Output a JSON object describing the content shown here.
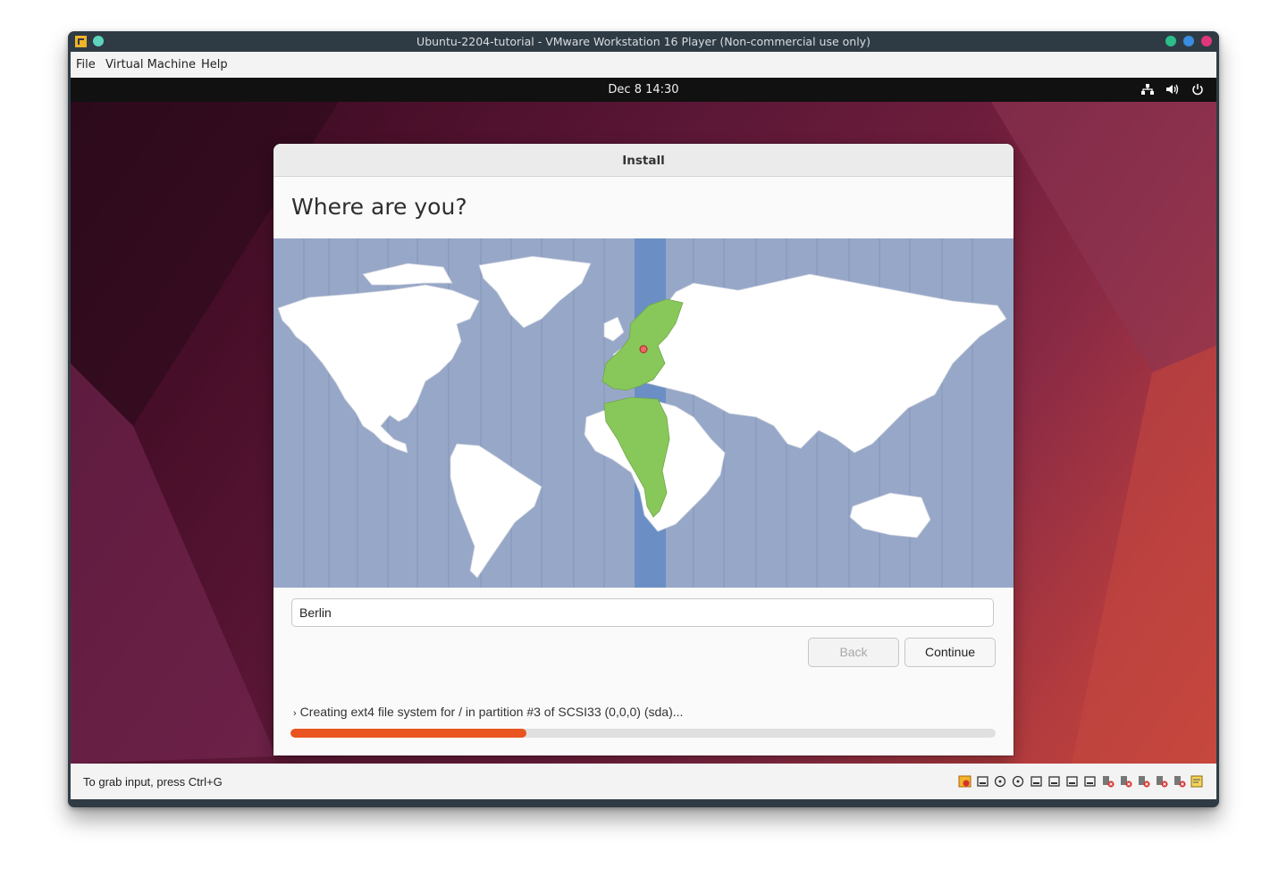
{
  "window": {
    "title": "Ubuntu-2204-tutorial - VMware Workstation 16 Player (Non-commercial use only)",
    "title_dot_colors": [
      "#5fd3be",
      "#2bbe8b",
      "#3a8de0",
      "#e0367a"
    ]
  },
  "menubar": {
    "items": [
      "File",
      "Virtual Machine",
      "Help"
    ]
  },
  "topbar": {
    "clock": "Dec 8  14:30",
    "icons": [
      "network-icon",
      "volume-icon",
      "power-icon"
    ]
  },
  "installer": {
    "window_title": "Install",
    "heading": "Where are you?",
    "city_value": "Berlin",
    "back_label": "Back",
    "continue_label": "Continue",
    "progress_text": "Creating ext4 file system for / in partition #3 of SCSI33 (0,0,0) (sda)...",
    "progress_fraction": 0.335,
    "colors": {
      "accent": "#e95420",
      "highlight_zone": "#6b8fc4",
      "selected_region": "#88c85a",
      "ocean": "#97a7c8"
    }
  },
  "statusbar": {
    "message": "To grab input, press Ctrl+G",
    "device_icons": [
      "vm-settings-icon",
      "hard-disk-icon",
      "cd-icon",
      "cd-icon",
      "floppy-icon",
      "network-adapter-icon",
      "printer-icon",
      "display-icon",
      "usb-disconnected-icon",
      "usb-disconnected-icon",
      "usb-disconnected-icon",
      "usb-disconnected-icon",
      "usb-disconnected-icon",
      "message-icon"
    ]
  }
}
